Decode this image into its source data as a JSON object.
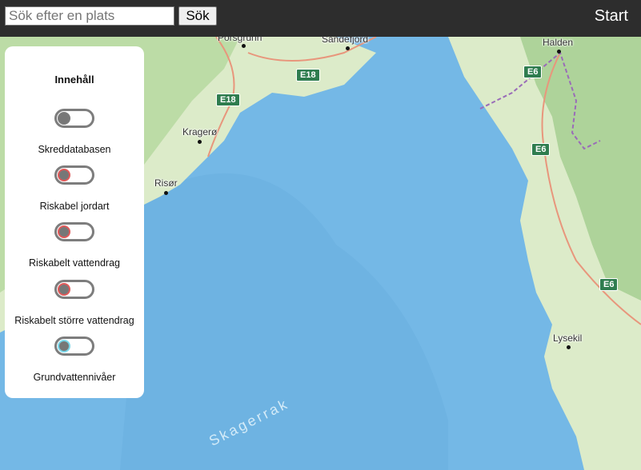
{
  "header": {
    "search_placeholder": "Sök efter en plats",
    "search_value": "",
    "search_button": "Sök",
    "start_link": "Start"
  },
  "panel": {
    "title": "Innehåll",
    "layers": [
      {
        "label": "Skreddatabasen",
        "ring_color": "#7a7a7a",
        "enabled": false
      },
      {
        "label": "Riskabel jordart",
        "ring_color": "#e05a5a",
        "enabled": false
      },
      {
        "label": "Riskabelt vattendrag",
        "ring_color": "#e05a5a",
        "enabled": false
      },
      {
        "label": "Riskabelt större vattendrag",
        "ring_color": "#e05a5a",
        "enabled": false
      },
      {
        "label": "Grundvattennivåer",
        "ring_color": "#7ad7ea",
        "enabled": false
      }
    ]
  },
  "map": {
    "places": [
      "Porsgrunn",
      "Sandefjord",
      "Halden",
      "Kragerø",
      "Risør",
      "Lysekil"
    ],
    "roads": [
      "E18",
      "E18",
      "E6",
      "E6",
      "E6"
    ],
    "sea": "Skagerrak",
    "colors": {
      "sea": "#74b8e6",
      "land": "#dcebc9",
      "forest": "#aed39a",
      "road": "#e8967c"
    }
  }
}
